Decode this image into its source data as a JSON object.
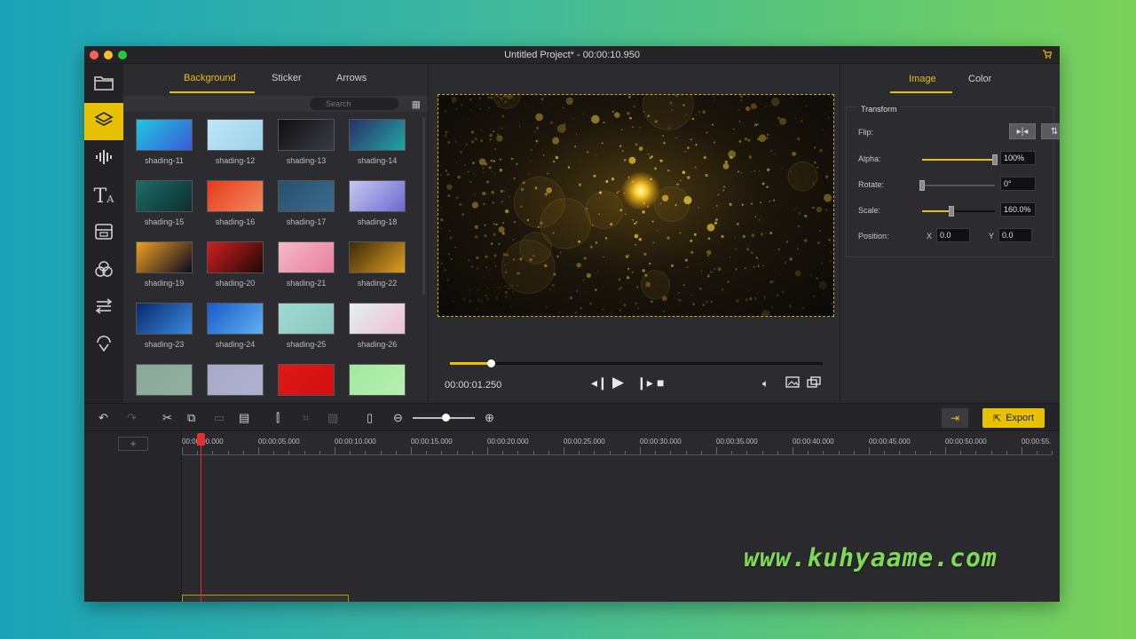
{
  "window": {
    "title": "Untitled Project* - 00:00:10.950"
  },
  "sidebar": {
    "items": [
      {
        "icon": "folder-icon",
        "name": "media"
      },
      {
        "icon": "layers-icon",
        "name": "background",
        "active": true
      },
      {
        "icon": "audio-wave-icon",
        "name": "audio"
      },
      {
        "icon": "text-icon",
        "name": "text"
      },
      {
        "icon": "overlay-icon",
        "name": "overlay"
      },
      {
        "icon": "filter-circles-icon",
        "name": "filters"
      },
      {
        "icon": "transition-icon",
        "name": "transitions"
      },
      {
        "icon": "element-icon",
        "name": "elements"
      }
    ]
  },
  "media_panel": {
    "tabs": [
      "Background",
      "Sticker",
      "Arrows"
    ],
    "active_tab": "Background",
    "search_placeholder": "Search",
    "items": [
      {
        "label": "shading-11",
        "colors": [
          "#1ec8e0",
          "#3a5ad8"
        ]
      },
      {
        "label": "shading-12",
        "colors": [
          "#bfe6f5",
          "#9fd2ec"
        ]
      },
      {
        "label": "shading-13",
        "colors": [
          "#101012",
          "#3a3a44"
        ]
      },
      {
        "label": "shading-14",
        "colors": [
          "#2a2f6a",
          "#20a8a0"
        ]
      },
      {
        "label": "shading-15",
        "colors": [
          "#1c6b68",
          "#0c2e2e"
        ]
      },
      {
        "label": "shading-16",
        "colors": [
          "#e83a1a",
          "#f08a60"
        ]
      },
      {
        "label": "shading-17",
        "colors": [
          "#2a4f6e",
          "#3b6b8c"
        ]
      },
      {
        "label": "shading-18",
        "colors": [
          "#c8c8f0",
          "#6a6ad0"
        ]
      },
      {
        "label": "shading-19",
        "colors": [
          "#f0a020",
          "#0a0a20"
        ]
      },
      {
        "label": "shading-20",
        "colors": [
          "#d02020",
          "#200808"
        ]
      },
      {
        "label": "shading-21",
        "colors": [
          "#f5b8c8",
          "#e880a0"
        ]
      },
      {
        "label": "shading-22",
        "colors": [
          "#3a2a08",
          "#e0a020"
        ]
      },
      {
        "label": "shading-23",
        "colors": [
          "#0a2a6a",
          "#3a8ae0"
        ]
      },
      {
        "label": "shading-24",
        "colors": [
          "#1a5ac8",
          "#60b0f0"
        ]
      },
      {
        "label": "shading-25",
        "colors": [
          "#a0d8d0",
          "#8cc8c0"
        ]
      },
      {
        "label": "shading-26",
        "colors": [
          "#e0f0f0",
          "#f0c0d0"
        ]
      },
      {
        "label": "",
        "colors": [
          "#8aa898",
          "#90b0a0"
        ]
      },
      {
        "label": "",
        "colors": [
          "#a8a8c8",
          "#b0b0d0"
        ]
      },
      {
        "label": "",
        "colors": [
          "#e01818",
          "#d01010"
        ]
      },
      {
        "label": "",
        "colors": [
          "#a0e8a0",
          "#b8f0b0"
        ]
      }
    ]
  },
  "preview": {
    "current_time": "00:00:01.250",
    "progress": 0.11
  },
  "properties": {
    "tabs": [
      "Image",
      "Color"
    ],
    "active_tab": "Image",
    "section": "Transform",
    "flip_label": "Flip:",
    "alpha_label": "Alpha:",
    "alpha_value": "100%",
    "alpha_level": 1.0,
    "rotate_label": "Rotate:",
    "rotate_value": "0°",
    "rotate_level": 0.0,
    "scale_label": "Scale:",
    "scale_value": "160.0%",
    "scale_level": 0.4,
    "position_label": "Position:",
    "x_label": "X",
    "x_value": "0.0",
    "y_label": "Y",
    "y_value": "0.0"
  },
  "toolbar": {
    "export_label": "Export"
  },
  "timeline": {
    "add_track": "+",
    "ruler": [
      "00:00:00.000",
      "00:00:05.000",
      "00:00:10.000",
      "00:00:15.000",
      "00:00:20.000",
      "00:00:25.000",
      "00:00:30.000",
      "00:00:35.000",
      "00:00:40.000",
      "00:00:45.000",
      "00:00:50.000",
      "00:00:55."
    ]
  },
  "watermark": "www.kuhyaame.com",
  "colors": {
    "accent": "#e8c200",
    "playhead": "#e03030",
    "window_bg": "#2b2b30"
  }
}
